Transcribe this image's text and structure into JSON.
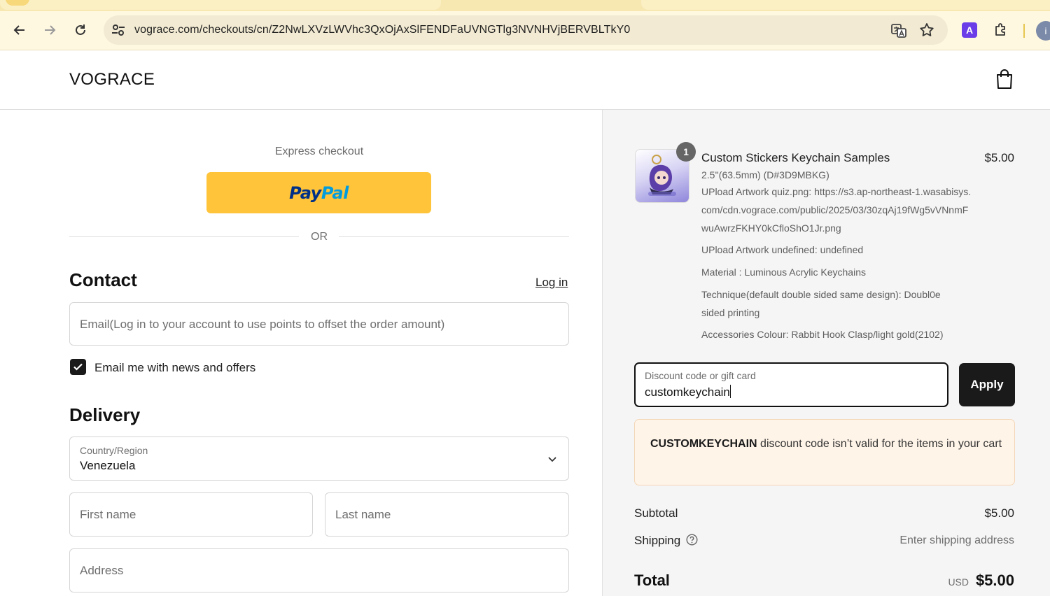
{
  "browser": {
    "url": "vograce.com/checkouts/cn/Z2NwLXVzLWVhc3QxOjAxSlFENDFaUVNGTlg3NVNHVjBERVBLTkY0",
    "extension_letter": "A",
    "profile_initial": "i",
    "icons": [
      "back-icon",
      "forward-icon",
      "reload-icon",
      "site-settings-icon",
      "translate-icon",
      "star-icon",
      "extension-icon",
      "puzzle-icon",
      "profile-icon"
    ]
  },
  "store": {
    "logo": "VOGRACE",
    "cart_icon": "shopping-bag-icon"
  },
  "express": {
    "title": "Express checkout",
    "paypal_pay": "Pay",
    "paypal_pal": "Pal",
    "or": "OR"
  },
  "contact": {
    "heading": "Contact",
    "login": "Log in",
    "email_placeholder": "Email(Log in to your account to use points to offset the order amount)",
    "newsletter_label": "Email me with news and offers",
    "newsletter_checked": true
  },
  "delivery": {
    "heading": "Delivery",
    "country_label": "Country/Region",
    "country_value": "Venezuela",
    "first_name_placeholder": "First name",
    "last_name_placeholder": "Last name",
    "address_placeholder": "Address"
  },
  "order": {
    "item": {
      "quantity": "1",
      "name": "Custom Stickers Keychain Samples",
      "price": "$5.00",
      "props": [
        "2.5''(63.5mm) (D#3D9MBKG)",
        "UPload Artwork quiz.png: https://s3.ap-northeast-1.wasabisys.com/cdn.vograce.com/public/2025/03/30zqAj19fWg5vVNnmFwuAwrzFKHY0kCfloShO1Jr.png",
        "UPload Artwork undefined: undefined",
        "Material : Luminous Acrylic Keychains",
        "Technique(default double sided same design): Doubl0e sided printing",
        "Accessories Colour: Rabbit Hook Clasp/light gold(2102)"
      ]
    },
    "discount": {
      "label": "Discount code or gift card",
      "value": "customkeychain",
      "apply": "Apply"
    },
    "error": {
      "code": "CUSTOMKEYCHAIN",
      "message": " discount code isn’t valid for the items in your cart"
    },
    "subtotal_label": "Subtotal",
    "subtotal_value": "$5.00",
    "shipping_label": "Shipping",
    "shipping_value": "Enter shipping address",
    "total_label": "Total",
    "total_currency": "USD",
    "total_value": "$5.00"
  }
}
